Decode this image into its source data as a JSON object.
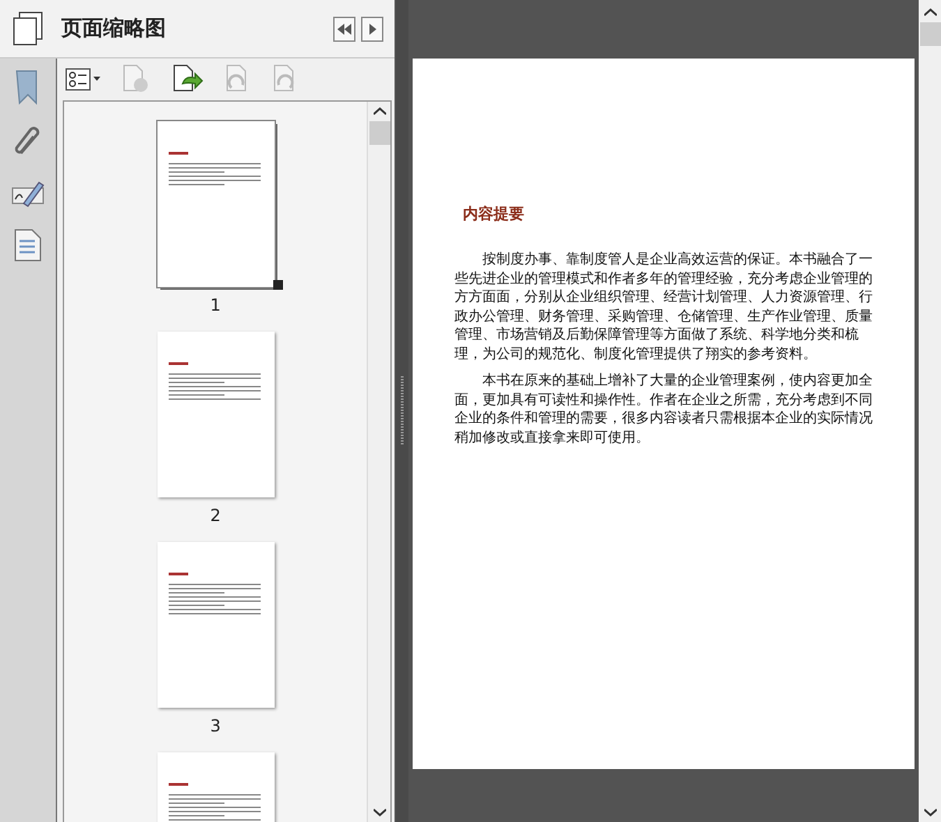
{
  "panel": {
    "title": "页面缩略图"
  },
  "thumbnails": [
    {
      "page_number": "1",
      "selected": true
    },
    {
      "page_number": "2",
      "selected": false
    },
    {
      "page_number": "3",
      "selected": false
    },
    {
      "selected": false
    }
  ],
  "document": {
    "heading": "内容提要",
    "paragraphs": [
      "按制度办事、靠制度管人是企业高效运营的保证。本书融合了一些先进企业的管理模式和作者多年的管理经验，充分考虑企业管理的方方面面，分别从企业组织管理、经营计划管理、人力资源管理、行政办公管理、财务管理、采购管理、仓储管理、生产作业管理、质量管理、市场营销及后勤保障管理等方面做了系统、科学地分类和梳理，为公司的规范化、制度化管理提供了翔实的参考资料。",
      "本书在原来的基础上增补了大量的企业管理案例，使内容更加全面，更加具有可读性和操作性。作者在企业之所需，充分考虑到不同企业的条件和管理的需要，很多内容读者只需根据本企业的实际情况稍加修改或直接拿来即可使用。"
    ]
  }
}
